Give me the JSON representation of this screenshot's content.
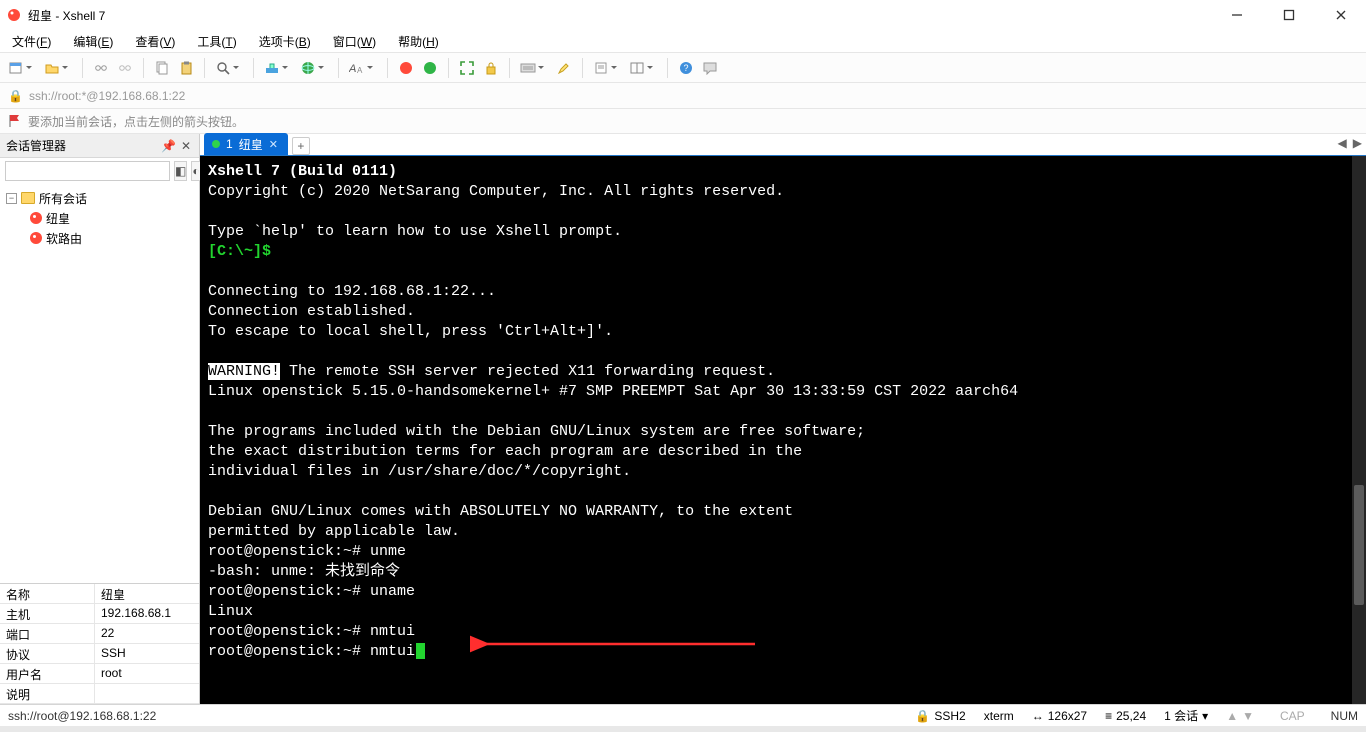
{
  "title": {
    "text": "纽皇 - Xshell 7"
  },
  "menus": {
    "file": "文件(",
    "file_k": "F",
    "edit": "编辑(",
    "edit_k": "E",
    "view": "查看(",
    "view_k": "V",
    "tools": "工具(",
    "tools_k": "T",
    "tabs": "选项卡(",
    "tabs_k": "B",
    "window": "窗口(",
    "window_k": "W",
    "help": "帮助(",
    "help_k": "H",
    "close_paren": ")"
  },
  "addr": "ssh://root:*@192.168.68.1:22",
  "hint": "要添加当前会话，点击左侧的箭头按钮。",
  "sidebar": {
    "title": "会话管理器",
    "root": "所有会话",
    "items": [
      "纽皇",
      "软路由"
    ]
  },
  "props": {
    "name_k": "名称",
    "name_v": "纽皇",
    "host_k": "主机",
    "host_v": "192.168.68.1",
    "port_k": "端口",
    "port_v": "22",
    "proto_k": "协议",
    "proto_v": "SSH",
    "user_k": "用户名",
    "user_v": "root",
    "desc_k": "说明",
    "desc_v": ""
  },
  "tab": {
    "index": "1",
    "name": "纽皇"
  },
  "term": {
    "l1": "Xshell 7 (Build 0111)",
    "l2": "Copyright (c) 2020 NetSarang Computer, Inc. All rights reserved.",
    "l3": "Type `help' to learn how to use Xshell prompt.",
    "l4": "[C:\\~]$",
    "l5": "Connecting to 192.168.68.1:22...",
    "l6": "Connection established.",
    "l7": "To escape to local shell, press 'Ctrl+Alt+]'.",
    "warn": "WARNING!",
    "l8": " The remote SSH server rejected X11 forwarding request.",
    "l9": "Linux openstick 5.15.0-handsomekernel+ #7 SMP PREEMPT Sat Apr 30 13:33:59 CST 2022 aarch64",
    "l10": "The programs included with the Debian GNU/Linux system are free software;",
    "l11": "the exact distribution terms for each program are described in the",
    "l12": "individual files in /usr/share/doc/*/copyright.",
    "l13": "Debian GNU/Linux comes with ABSOLUTELY NO WARRANTY, to the extent",
    "l14": "permitted by applicable law.",
    "p1": "root@openstick:~# unme",
    "p1r": "-bash: unme: 未找到命令",
    "p2": "root@openstick:~# uname",
    "p2r": "Linux",
    "p3": "root@openstick:~# nmtui",
    "p4a": "root@openstick:~# ",
    "p4b": "nmtui"
  },
  "status": {
    "path": "ssh://root@192.168.68.1:22",
    "ssh": "SSH2",
    "term": "xterm",
    "size": "126x27",
    "cursor": "25,24",
    "sess": "1 会话",
    "cap": "CAP",
    "num": "NUM"
  }
}
